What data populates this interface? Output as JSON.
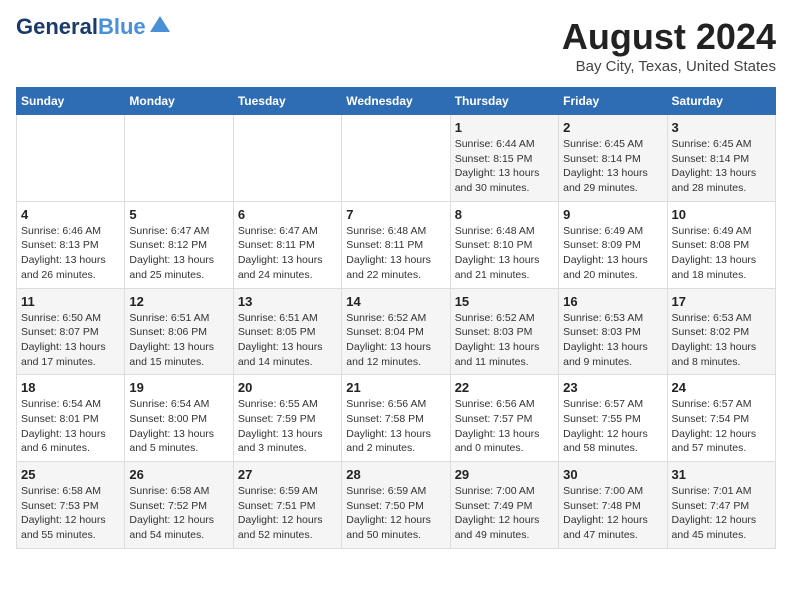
{
  "header": {
    "logo_line1": "General",
    "logo_line2": "Blue",
    "main_title": "August 2024",
    "subtitle": "Bay City, Texas, United States"
  },
  "days_of_week": [
    "Sunday",
    "Monday",
    "Tuesday",
    "Wednesday",
    "Thursday",
    "Friday",
    "Saturday"
  ],
  "weeks": [
    [
      {
        "day": "",
        "content": ""
      },
      {
        "day": "",
        "content": ""
      },
      {
        "day": "",
        "content": ""
      },
      {
        "day": "",
        "content": ""
      },
      {
        "day": "1",
        "content": "Sunrise: 6:44 AM\nSunset: 8:15 PM\nDaylight: 13 hours\nand 30 minutes."
      },
      {
        "day": "2",
        "content": "Sunrise: 6:45 AM\nSunset: 8:14 PM\nDaylight: 13 hours\nand 29 minutes."
      },
      {
        "day": "3",
        "content": "Sunrise: 6:45 AM\nSunset: 8:14 PM\nDaylight: 13 hours\nand 28 minutes."
      }
    ],
    [
      {
        "day": "4",
        "content": "Sunrise: 6:46 AM\nSunset: 8:13 PM\nDaylight: 13 hours\nand 26 minutes."
      },
      {
        "day": "5",
        "content": "Sunrise: 6:47 AM\nSunset: 8:12 PM\nDaylight: 13 hours\nand 25 minutes."
      },
      {
        "day": "6",
        "content": "Sunrise: 6:47 AM\nSunset: 8:11 PM\nDaylight: 13 hours\nand 24 minutes."
      },
      {
        "day": "7",
        "content": "Sunrise: 6:48 AM\nSunset: 8:11 PM\nDaylight: 13 hours\nand 22 minutes."
      },
      {
        "day": "8",
        "content": "Sunrise: 6:48 AM\nSunset: 8:10 PM\nDaylight: 13 hours\nand 21 minutes."
      },
      {
        "day": "9",
        "content": "Sunrise: 6:49 AM\nSunset: 8:09 PM\nDaylight: 13 hours\nand 20 minutes."
      },
      {
        "day": "10",
        "content": "Sunrise: 6:49 AM\nSunset: 8:08 PM\nDaylight: 13 hours\nand 18 minutes."
      }
    ],
    [
      {
        "day": "11",
        "content": "Sunrise: 6:50 AM\nSunset: 8:07 PM\nDaylight: 13 hours\nand 17 minutes."
      },
      {
        "day": "12",
        "content": "Sunrise: 6:51 AM\nSunset: 8:06 PM\nDaylight: 13 hours\nand 15 minutes."
      },
      {
        "day": "13",
        "content": "Sunrise: 6:51 AM\nSunset: 8:05 PM\nDaylight: 13 hours\nand 14 minutes."
      },
      {
        "day": "14",
        "content": "Sunrise: 6:52 AM\nSunset: 8:04 PM\nDaylight: 13 hours\nand 12 minutes."
      },
      {
        "day": "15",
        "content": "Sunrise: 6:52 AM\nSunset: 8:03 PM\nDaylight: 13 hours\nand 11 minutes."
      },
      {
        "day": "16",
        "content": "Sunrise: 6:53 AM\nSunset: 8:03 PM\nDaylight: 13 hours\nand 9 minutes."
      },
      {
        "day": "17",
        "content": "Sunrise: 6:53 AM\nSunset: 8:02 PM\nDaylight: 13 hours\nand 8 minutes."
      }
    ],
    [
      {
        "day": "18",
        "content": "Sunrise: 6:54 AM\nSunset: 8:01 PM\nDaylight: 13 hours\nand 6 minutes."
      },
      {
        "day": "19",
        "content": "Sunrise: 6:54 AM\nSunset: 8:00 PM\nDaylight: 13 hours\nand 5 minutes."
      },
      {
        "day": "20",
        "content": "Sunrise: 6:55 AM\nSunset: 7:59 PM\nDaylight: 13 hours\nand 3 minutes."
      },
      {
        "day": "21",
        "content": "Sunrise: 6:56 AM\nSunset: 7:58 PM\nDaylight: 13 hours\nand 2 minutes."
      },
      {
        "day": "22",
        "content": "Sunrise: 6:56 AM\nSunset: 7:57 PM\nDaylight: 13 hours\nand 0 minutes."
      },
      {
        "day": "23",
        "content": "Sunrise: 6:57 AM\nSunset: 7:55 PM\nDaylight: 12 hours\nand 58 minutes."
      },
      {
        "day": "24",
        "content": "Sunrise: 6:57 AM\nSunset: 7:54 PM\nDaylight: 12 hours\nand 57 minutes."
      }
    ],
    [
      {
        "day": "25",
        "content": "Sunrise: 6:58 AM\nSunset: 7:53 PM\nDaylight: 12 hours\nand 55 minutes."
      },
      {
        "day": "26",
        "content": "Sunrise: 6:58 AM\nSunset: 7:52 PM\nDaylight: 12 hours\nand 54 minutes."
      },
      {
        "day": "27",
        "content": "Sunrise: 6:59 AM\nSunset: 7:51 PM\nDaylight: 12 hours\nand 52 minutes."
      },
      {
        "day": "28",
        "content": "Sunrise: 6:59 AM\nSunset: 7:50 PM\nDaylight: 12 hours\nand 50 minutes."
      },
      {
        "day": "29",
        "content": "Sunrise: 7:00 AM\nSunset: 7:49 PM\nDaylight: 12 hours\nand 49 minutes."
      },
      {
        "day": "30",
        "content": "Sunrise: 7:00 AM\nSunset: 7:48 PM\nDaylight: 12 hours\nand 47 minutes."
      },
      {
        "day": "31",
        "content": "Sunrise: 7:01 AM\nSunset: 7:47 PM\nDaylight: 12 hours\nand 45 minutes."
      }
    ]
  ]
}
